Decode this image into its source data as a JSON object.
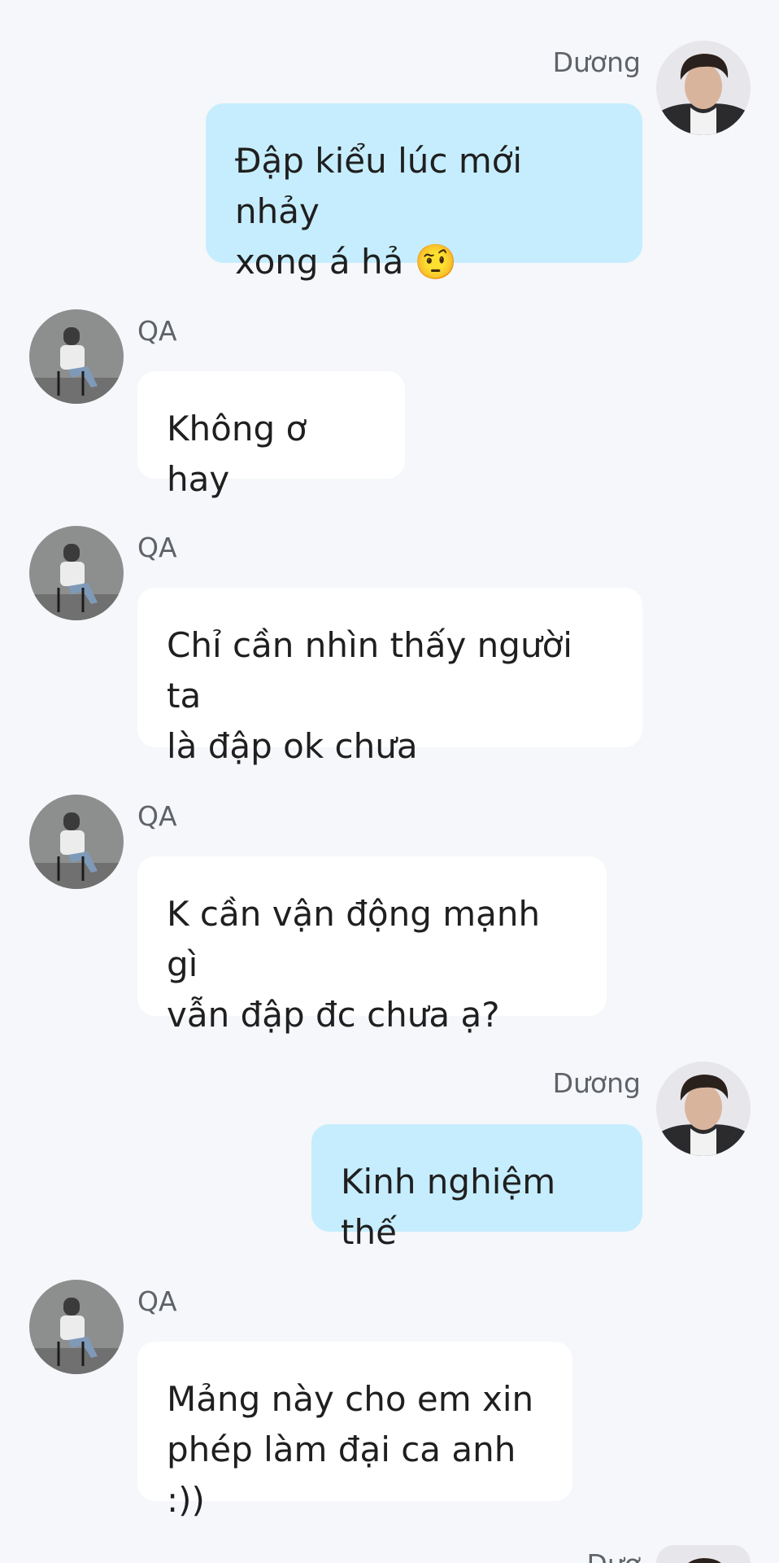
{
  "messages": [
    {
      "sender": "Dương",
      "text": "Đập kiểu lúc mới nhảy\nxong á hả 🤨"
    },
    {
      "sender": "QA",
      "text": "Không ơ hay"
    },
    {
      "sender": "QA",
      "text": "Chỉ cần nhìn thấy người ta\nlà đập ok chưa"
    },
    {
      "sender": "QA",
      "text": "K cần vận động mạnh gì\nvẫn đập đc chưa ạ?"
    },
    {
      "sender": "Dương",
      "text": "Kinh nghiệm thế"
    },
    {
      "sender": "QA",
      "text": "Mảng này cho em xin\nphép làm đại ca anh :))"
    },
    {
      "sender": "Dươ"
    }
  ],
  "colors": {
    "background": "#f5f7fa",
    "outgoing_bubble": "#c6edfd",
    "incoming_bubble": "#ffffff"
  },
  "icons": {
    "outgoing_avatar": "user-photo-duong",
    "incoming_avatar": "user-photo-qa"
  }
}
